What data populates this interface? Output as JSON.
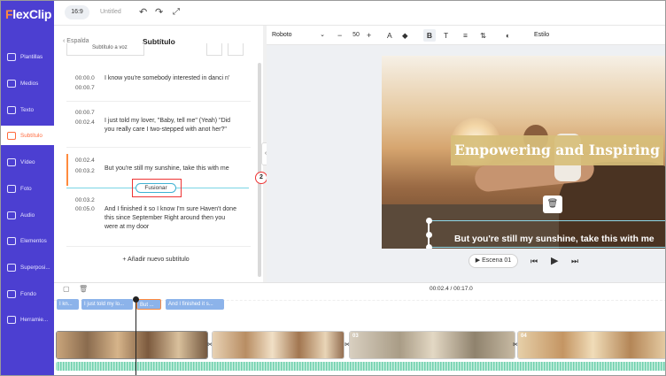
{
  "app": {
    "logo": "FlexClip",
    "ratio": "16:9",
    "untitled": "Untitled"
  },
  "sidebar": {
    "items": [
      {
        "label": "Plantillas",
        "icon": "templates-icon"
      },
      {
        "label": "Medios",
        "icon": "media-icon"
      },
      {
        "label": "Texto",
        "icon": "text-icon"
      },
      {
        "label": "Subtítulo",
        "icon": "subtitle-icon"
      },
      {
        "label": "Vídeo",
        "icon": "video-icon"
      },
      {
        "label": "Foto",
        "icon": "photo-icon"
      },
      {
        "label": "Audio",
        "icon": "audio-icon"
      },
      {
        "label": "Elementos",
        "icon": "elements-icon"
      },
      {
        "label": "Superposi...",
        "icon": "overlay-icon"
      },
      {
        "label": "Fondo",
        "icon": "background-icon"
      },
      {
        "label": "Herramie...",
        "icon": "tools-icon"
      }
    ],
    "active_index": 3
  },
  "panel": {
    "back": "Espalda",
    "title": "Subtítulo",
    "subtitle_button": "Subtítulo a voz",
    "entries": [
      {
        "start": "00:00.0",
        "end": "00:00.7",
        "text": "I know you're somebody interested in danci n'"
      },
      {
        "start": "00:00.7",
        "end": "00:02.4",
        "text": "I just told my lover, \"Baby, tell me\" (Yeah) \"Did you really care I two-stepped with anot her?\""
      },
      {
        "start": "00:02.4",
        "end": "00:03.2",
        "text": "But you're still my sunshine, take this with me"
      },
      {
        "start": "00:03.2",
        "end": "00:05.0",
        "text": "And I finished it so I know I'm sure Haven't done this since September Right around then you were at my door"
      }
    ],
    "merge_button": "Fusionar",
    "add_subtitle": "Añadir nuevo subtítulo",
    "step_badge": "2"
  },
  "text_toolbar": {
    "font": "Roboto",
    "size": "50",
    "style": "Estilo"
  },
  "canvas": {
    "title": "Empowering and Inspiring",
    "caption": "But you're still my sunshine, take this with me",
    "scene": "Escena 01"
  },
  "timeline": {
    "time": "00:02.4 / 00:17.0",
    "subtitle_clips": [
      "I kn...",
      "I just told my lo...",
      "But ...",
      "And I finished it s..."
    ],
    "scene_numbers": [
      "",
      "",
      "03",
      "04"
    ]
  },
  "colors": {
    "sidebar": "#4c3fd1",
    "accent": "#ff6a3d",
    "title_band": "#d7be7a"
  }
}
